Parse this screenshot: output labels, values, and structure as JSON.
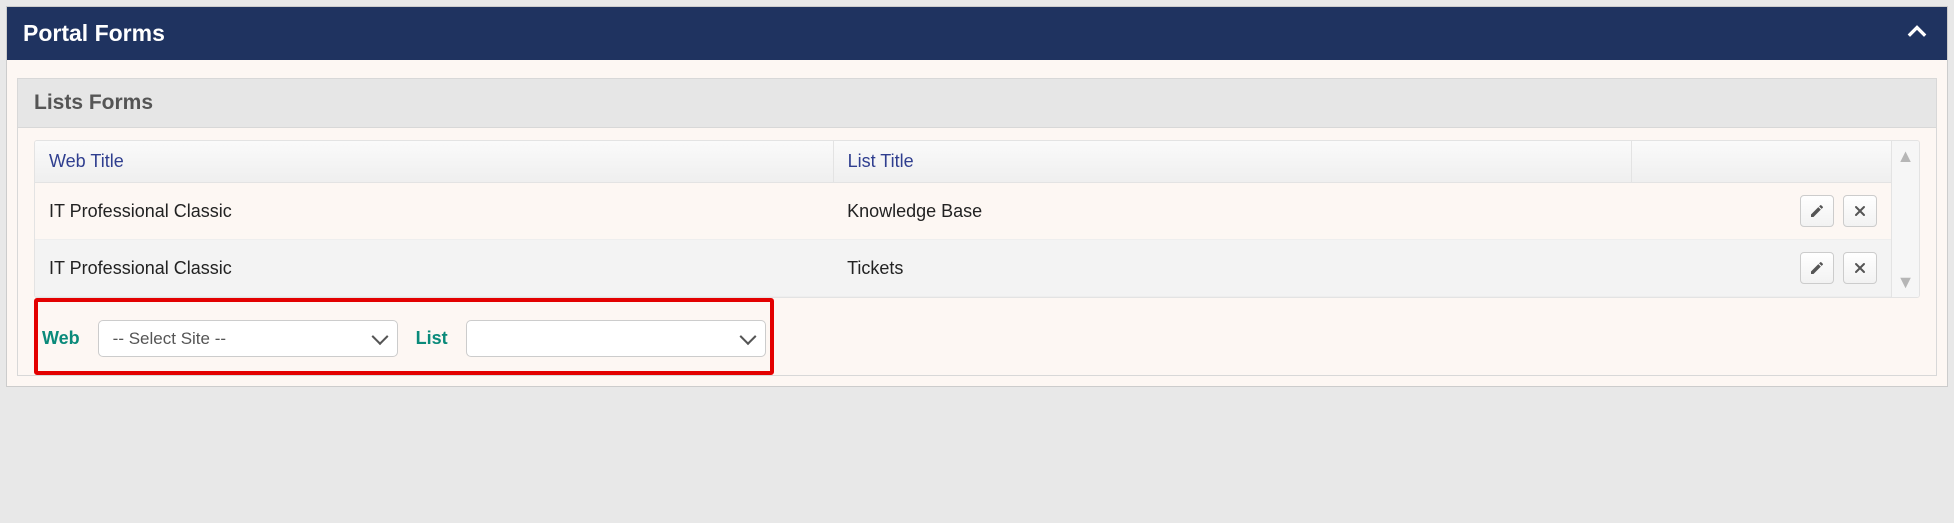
{
  "panel": {
    "title": "Portal Forms"
  },
  "subsection": {
    "title": "Lists Forms"
  },
  "columns": {
    "web": "Web Title",
    "list": "List Title",
    "actions": ""
  },
  "rows": [
    {
      "web": "IT Professional Classic",
      "list": "Knowledge Base"
    },
    {
      "web": "IT Professional Classic",
      "list": "Tickets"
    }
  ],
  "footer": {
    "web_label": "Web",
    "web_placeholder": "-- Select Site --",
    "list_label": "List",
    "list_placeholder": ""
  }
}
